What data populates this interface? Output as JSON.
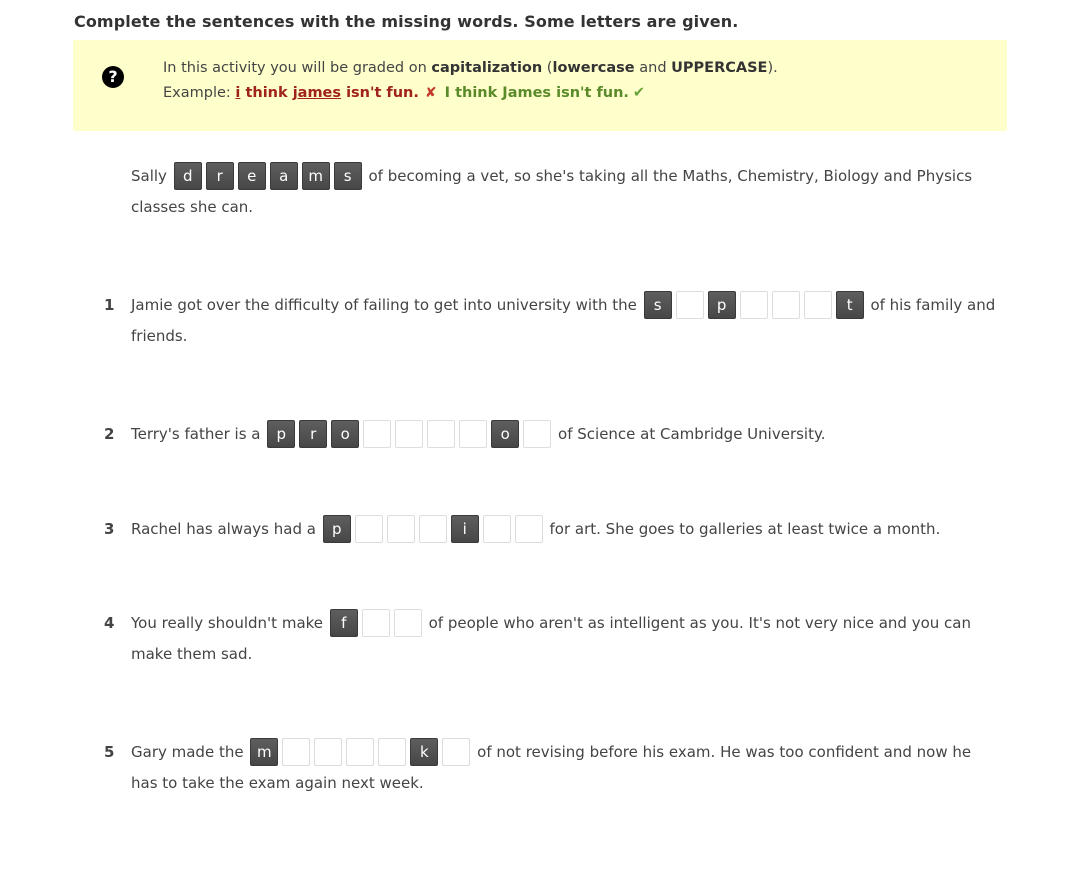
{
  "instruction": "Complete the sentences with the missing words. Some letters are given.",
  "info": {
    "icon": "question-circle-icon",
    "line1_pre": "In this activity you will be graded on ",
    "line1_bold1": "capitalization",
    "line1_mid1": " (",
    "line1_bold2": "lowercase",
    "line1_mid2": " and ",
    "line1_bold3": "UPPERCASE",
    "line1_end": ").",
    "example_label": "Example: ",
    "wrong_i": "i",
    "wrong_think": " think ",
    "wrong_james": "james",
    "wrong_rest": " isn't fun.",
    "wrong_mark": "✘",
    "right_text": "I think James isn't fun.",
    "right_mark": "✔"
  },
  "items": [
    {
      "number": "",
      "before": "Sally",
      "letters": [
        "d",
        "r",
        "e",
        "a",
        "m",
        "s"
      ],
      "given": [
        true,
        true,
        true,
        true,
        true,
        true
      ],
      "after": "of becoming a vet, so she's taking all the Maths, Chemistry, Biology and Physics classes she can."
    },
    {
      "number": "1",
      "before": "Jamie got over the difficulty of failing to get into university with the",
      "letters": [
        "s",
        "",
        "p",
        "",
        "",
        "",
        "t"
      ],
      "given": [
        true,
        false,
        true,
        false,
        false,
        false,
        true
      ],
      "after": "of his family and friends."
    },
    {
      "number": "2",
      "before": "Terry's father is a",
      "letters": [
        "p",
        "r",
        "o",
        "",
        "",
        "",
        "",
        "o",
        ""
      ],
      "given": [
        true,
        true,
        true,
        false,
        false,
        false,
        false,
        true,
        false
      ],
      "after": "of Science at Cambridge University."
    },
    {
      "number": "3",
      "before": "Rachel has always had a",
      "letters": [
        "p",
        "",
        "",
        "",
        "i",
        "",
        ""
      ],
      "given": [
        true,
        false,
        false,
        false,
        true,
        false,
        false
      ],
      "after": "for art. She goes to galleries at least twice a month."
    },
    {
      "number": "4",
      "before": "You really shouldn't make",
      "letters": [
        "f",
        "",
        ""
      ],
      "given": [
        true,
        false,
        false
      ],
      "after": "of people who aren't as intelligent as you. It's not very nice and you can make them sad."
    },
    {
      "number": "5",
      "before": "Gary made the",
      "letters": [
        "m",
        "",
        "",
        "",
        "",
        "k",
        ""
      ],
      "given": [
        true,
        false,
        false,
        false,
        false,
        true,
        false
      ],
      "after": "of not revising before his exam. He was too confident and now he has to take the exam again next week."
    }
  ]
}
